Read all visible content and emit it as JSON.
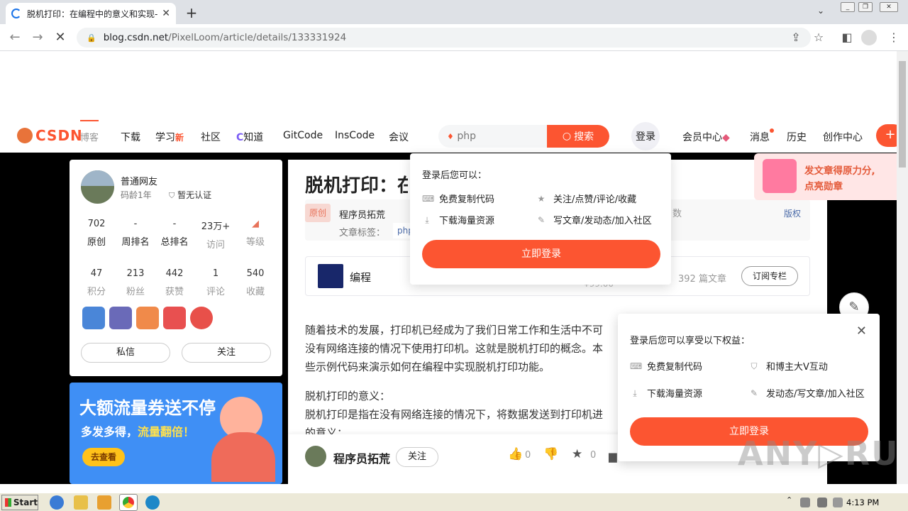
{
  "browser": {
    "tab_title": "脱机打印：在编程中的意义和实现-C",
    "tab_close": "✕",
    "new_tab": "+",
    "url_domain": "blog.csdn.net",
    "url_path": "/PixelLoom/article/details/133331924"
  },
  "nav": {
    "logo": "CSDN",
    "items": [
      "博客",
      "下载",
      "学习",
      "社区",
      "知道",
      "GitCode",
      "InsCode",
      "会议"
    ],
    "learn_new": "新",
    "search_placeholder": "php",
    "search_button": "搜索",
    "login": "登录",
    "right_items": [
      "会员中心",
      "消息",
      "历史",
      "创作中心"
    ],
    "create_icon": "+"
  },
  "profile": {
    "name": "普通网友",
    "years": "码龄1年",
    "cert": "暂无认证",
    "stats_row1": [
      {
        "value": "702",
        "label": "原创"
      },
      {
        "value": "-",
        "label": "周排名"
      },
      {
        "value": "-",
        "label": "总排名"
      },
      {
        "value": "23万+",
        "label": "访问"
      },
      {
        "value": "",
        "label": "等级"
      }
    ],
    "stats_row2": [
      {
        "value": "47",
        "label": "积分"
      },
      {
        "value": "213",
        "label": "粉丝"
      },
      {
        "value": "442",
        "label": "获赞"
      },
      {
        "value": "1",
        "label": "评论"
      },
      {
        "value": "540",
        "label": "收藏"
      }
    ],
    "btn_message": "私信",
    "btn_follow": "关注"
  },
  "ad": {
    "line1": "大额流量券送不停",
    "line2_a": "多发多得，",
    "line2_b": "流量翻倍！",
    "button": "去查看"
  },
  "article": {
    "title": "脱机打印：在",
    "original": "原创",
    "author": "程序员拓荒",
    "tags_label": "文章标签：",
    "tag": "php",
    "partial_count": "数",
    "copyright": "版权",
    "column_name": "编程",
    "column_price": "¥99.00",
    "column_count": "392 篇文章",
    "subscribe": "订阅专栏",
    "para1_l1": "随着技术的发展，打印机已经成为了我们日常工作和生活中不可",
    "para1_l2": "没有网络连接的情况下使用打印机。这就是脱机打印的概念。本",
    "para1_l3": "些示例代码来演示如何在编程中实现脱机打印功能。",
    "para2_l1": "脱机打印的意义：",
    "para2_l2": "脱机打印是指在没有网络连接的情况下，将数据发送到打印机进",
    "para2_l3": "的意义："
  },
  "bottombar": {
    "author": "程序员拓荒",
    "follow": "关注",
    "like_count": "0",
    "star_count": "0"
  },
  "popup_login": {
    "header": "登录后您可以：",
    "items": [
      "免费复制代码",
      "关注/点赞/评论/收藏",
      "下载海量资源",
      "写文章/发动态/加入社区"
    ],
    "button": "立即登录"
  },
  "popup_benefits": {
    "header": "登录后您可以享受以下权益：",
    "close": "✕",
    "items": [
      "免费复制代码",
      "和博主大V互动",
      "下载海量资源",
      "发动态/写文章/加入社区"
    ],
    "button": "立即登录"
  },
  "gift": {
    "line1": "发文章得原力分,",
    "line2": "点亮勋章"
  },
  "taskbar": {
    "start": "Start",
    "clock": "4:13 PM"
  },
  "watermark": "ANY▷RUN",
  "colors": {
    "accent": "#fc5531",
    "dark_bg": "#000000"
  }
}
